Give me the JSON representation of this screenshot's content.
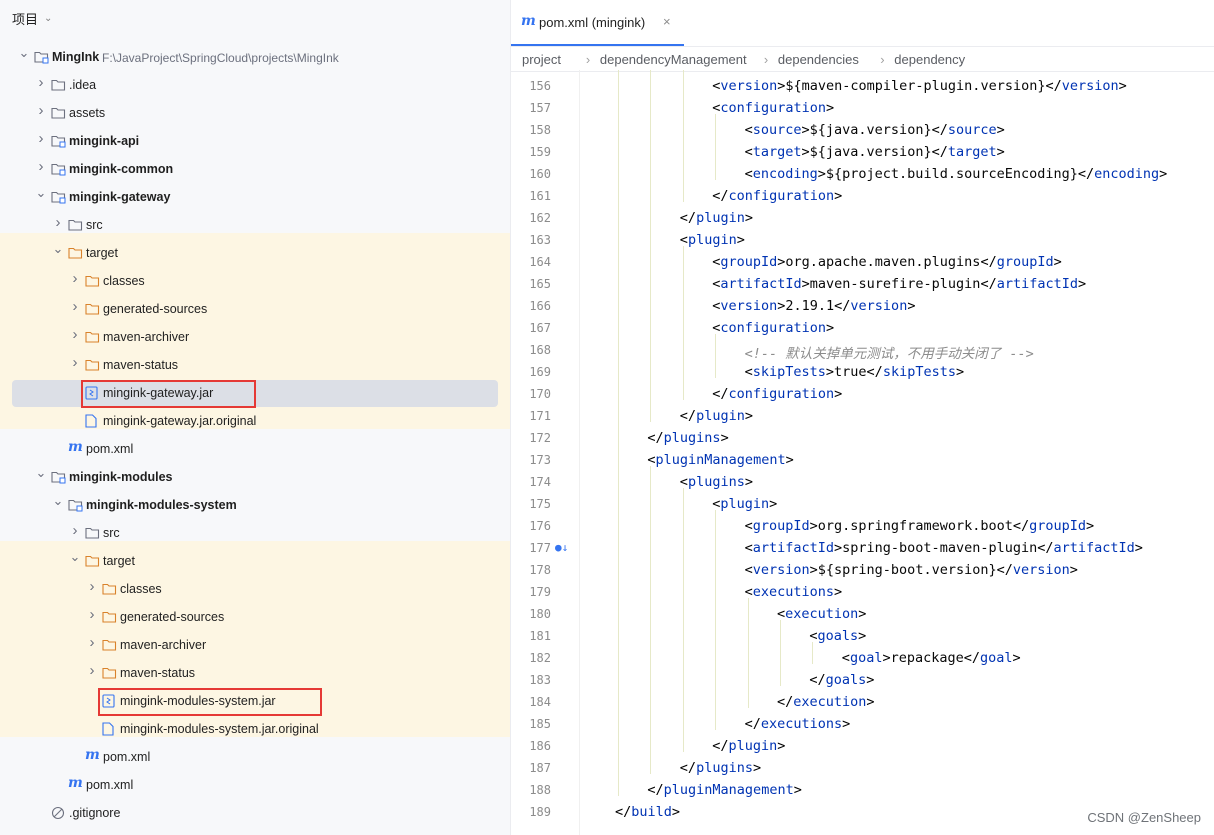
{
  "panel": {
    "title": "项目",
    "tree": [
      {
        "depth": 0,
        "type": "module",
        "label": "MingInk",
        "path": "F:\\JavaProject\\SpringCloud\\projects\\MingInk",
        "bold": true,
        "expanded": true
      },
      {
        "depth": 1,
        "type": "folder",
        "label": ".idea",
        "expanded": false
      },
      {
        "depth": 1,
        "type": "folder",
        "label": "assets",
        "expanded": false
      },
      {
        "depth": 1,
        "type": "module",
        "label": "mingink-api",
        "bold": true,
        "expanded": false
      },
      {
        "depth": 1,
        "type": "module",
        "label": "mingink-common",
        "bold": true,
        "expanded": false
      },
      {
        "depth": 1,
        "type": "module",
        "label": "mingink-gateway",
        "bold": true,
        "expanded": true
      },
      {
        "depth": 2,
        "type": "folder",
        "label": "src",
        "expanded": false
      },
      {
        "depth": 2,
        "type": "folder-excluded",
        "label": "target",
        "expanded": true
      },
      {
        "depth": 3,
        "type": "folder-excluded",
        "label": "classes",
        "expanded": false
      },
      {
        "depth": 3,
        "type": "folder-excluded",
        "label": "generated-sources",
        "expanded": false
      },
      {
        "depth": 3,
        "type": "folder-excluded",
        "label": "maven-archiver",
        "expanded": false
      },
      {
        "depth": 3,
        "type": "folder-excluded",
        "label": "maven-status",
        "expanded": false
      },
      {
        "depth": 3,
        "type": "jar",
        "label": "mingink-gateway.jar",
        "selected": true,
        "highlight": true
      },
      {
        "depth": 3,
        "type": "file",
        "label": "mingink-gateway.jar.original"
      },
      {
        "depth": 2,
        "type": "maven",
        "label": "pom.xml"
      },
      {
        "depth": 1,
        "type": "module",
        "label": "mingink-modules",
        "bold": true,
        "expanded": true
      },
      {
        "depth": 2,
        "type": "module",
        "label": "mingink-modules-system",
        "bold": true,
        "expanded": true
      },
      {
        "depth": 3,
        "type": "folder",
        "label": "src",
        "expanded": false
      },
      {
        "depth": 3,
        "type": "folder-excluded",
        "label": "target",
        "expanded": true
      },
      {
        "depth": 4,
        "type": "folder-excluded",
        "label": "classes",
        "expanded": false
      },
      {
        "depth": 4,
        "type": "folder-excluded",
        "label": "generated-sources",
        "expanded": false
      },
      {
        "depth": 4,
        "type": "folder-excluded",
        "label": "maven-archiver",
        "expanded": false
      },
      {
        "depth": 4,
        "type": "folder-excluded",
        "label": "maven-status",
        "expanded": false
      },
      {
        "depth": 4,
        "type": "jar",
        "label": "mingink-modules-system.jar",
        "highlight": true
      },
      {
        "depth": 4,
        "type": "file",
        "label": "mingink-modules-system.jar.original"
      },
      {
        "depth": 3,
        "type": "maven",
        "label": "pom.xml"
      },
      {
        "depth": 2,
        "type": "maven",
        "label": "pom.xml"
      },
      {
        "depth": 1,
        "type": "ignore",
        "label": ".gitignore"
      }
    ]
  },
  "editor": {
    "tab_title": "pom.xml (mingink)",
    "tab_close": "×",
    "tab_icon": "maven-m-icon",
    "breadcrumb": [
      "project",
      "dependencyManagement",
      "dependencies",
      "dependency"
    ],
    "breadcrumb_sep": "›",
    "lines": [
      {
        "n": "156",
        "indent": 4,
        "open": "version",
        "text": "${maven-compiler-plugin.version}",
        "close": "version"
      },
      {
        "n": "157",
        "indent": 4,
        "open": "configuration"
      },
      {
        "n": "158",
        "indent": 5,
        "open": "source",
        "text": "${java.version}",
        "close": "source"
      },
      {
        "n": "159",
        "indent": 5,
        "open": "target",
        "text": "${java.version}",
        "close": "target"
      },
      {
        "n": "160",
        "indent": 5,
        "open": "encoding",
        "text": "${project.build.sourceEncoding}",
        "close": "encoding"
      },
      {
        "n": "161",
        "indent": 4,
        "close": "configuration"
      },
      {
        "n": "162",
        "indent": 3,
        "close": "plugin"
      },
      {
        "n": "163",
        "indent": 3,
        "open": "plugin"
      },
      {
        "n": "164",
        "indent": 4,
        "open": "groupId",
        "text": "org.apache.maven.plugins",
        "close": "groupId"
      },
      {
        "n": "165",
        "indent": 4,
        "open": "artifactId",
        "text": "maven-surefire-plugin",
        "close": "artifactId"
      },
      {
        "n": "166",
        "indent": 4,
        "open": "version",
        "text": "2.19.1",
        "close": "version"
      },
      {
        "n": "167",
        "indent": 4,
        "open": "configuration"
      },
      {
        "n": "168",
        "indent": 5,
        "comment": "<!-- 默认关掉单元测试，不用手动关闭了 -->"
      },
      {
        "n": "169",
        "indent": 5,
        "open": "skipTests",
        "text": "true",
        "close": "skipTests"
      },
      {
        "n": "170",
        "indent": 4,
        "close": "configuration"
      },
      {
        "n": "171",
        "indent": 3,
        "close": "plugin"
      },
      {
        "n": "172",
        "indent": 2,
        "close": "plugins"
      },
      {
        "n": "173",
        "indent": 2,
        "open": "pluginManagement"
      },
      {
        "n": "174",
        "indent": 3,
        "open": "plugins"
      },
      {
        "n": "175",
        "indent": 4,
        "open": "plugin"
      },
      {
        "n": "176",
        "indent": 5,
        "open": "groupId",
        "text": "org.springframework.boot",
        "close": "groupId"
      },
      {
        "n": "177",
        "indent": 5,
        "open": "artifactId",
        "text": "spring-boot-maven-plugin",
        "close": "artifactId",
        "gutter_icon": true
      },
      {
        "n": "178",
        "indent": 5,
        "open": "version",
        "text": "${spring-boot.version}",
        "close": "version"
      },
      {
        "n": "179",
        "indent": 5,
        "open": "executions"
      },
      {
        "n": "180",
        "indent": 6,
        "open": "execution"
      },
      {
        "n": "181",
        "indent": 7,
        "open": "goals"
      },
      {
        "n": "182",
        "indent": 8,
        "open": "goal",
        "text": "repackage",
        "close": "goal"
      },
      {
        "n": "183",
        "indent": 7,
        "close": "goals"
      },
      {
        "n": "184",
        "indent": 6,
        "close": "execution"
      },
      {
        "n": "185",
        "indent": 5,
        "close": "executions"
      },
      {
        "n": "186",
        "indent": 4,
        "close": "plugin"
      },
      {
        "n": "187",
        "indent": 3,
        "close": "plugins"
      },
      {
        "n": "188",
        "indent": 2,
        "close": "pluginManagement"
      },
      {
        "n": "189",
        "indent": 1,
        "close": "build"
      }
    ]
  },
  "watermark": "CSDN @ZenSheep",
  "colors": {
    "tag": "#0033b3",
    "comment": "#8c8c8c",
    "accent": "#3574f0",
    "highlight": "#e53935",
    "excluded_band": "#fdf6e3",
    "folder_excluded": "#d9822b"
  }
}
